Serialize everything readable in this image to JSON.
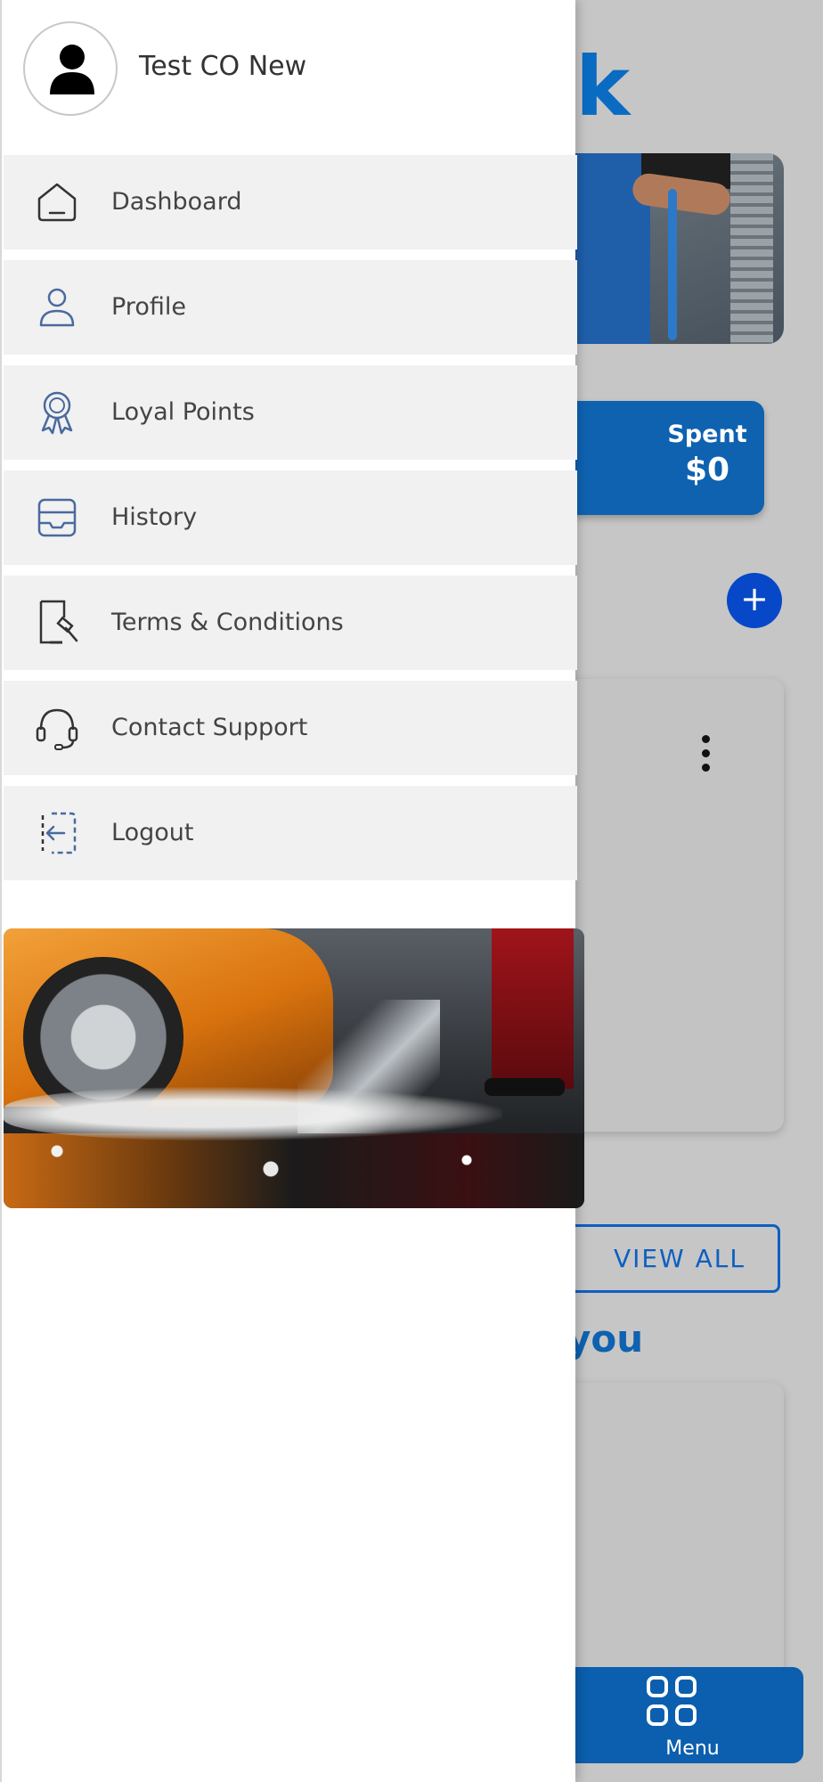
{
  "drawer": {
    "user_name": "Test CO New",
    "items": [
      {
        "label": "Dashboard",
        "icon": "home-icon"
      },
      {
        "label": "Profile",
        "icon": "user-icon"
      },
      {
        "label": "Loyal Points",
        "icon": "award-ribbon-icon"
      },
      {
        "label": "History",
        "icon": "inbox-tray-icon"
      },
      {
        "label": "Terms & Conditions",
        "icon": "document-gavel-icon"
      },
      {
        "label": "Contact Support",
        "icon": "headset-icon"
      },
      {
        "label": "Logout",
        "icon": "logout-icon"
      }
    ],
    "promo_image": "car-wash-photo"
  },
  "background": {
    "brand_fragment": "k",
    "spent_label": "Spent",
    "spent_value": "$0",
    "add_symbol": "+",
    "view_all": "VIEW ALL",
    "section_fragment": "you",
    "bottom_nav_label": "Menu"
  },
  "colors": {
    "accent": "#0e62b0",
    "fab": "#0648c8",
    "drawer_item_bg": "#f1f1f1",
    "overlay": "#c6c6c6"
  }
}
